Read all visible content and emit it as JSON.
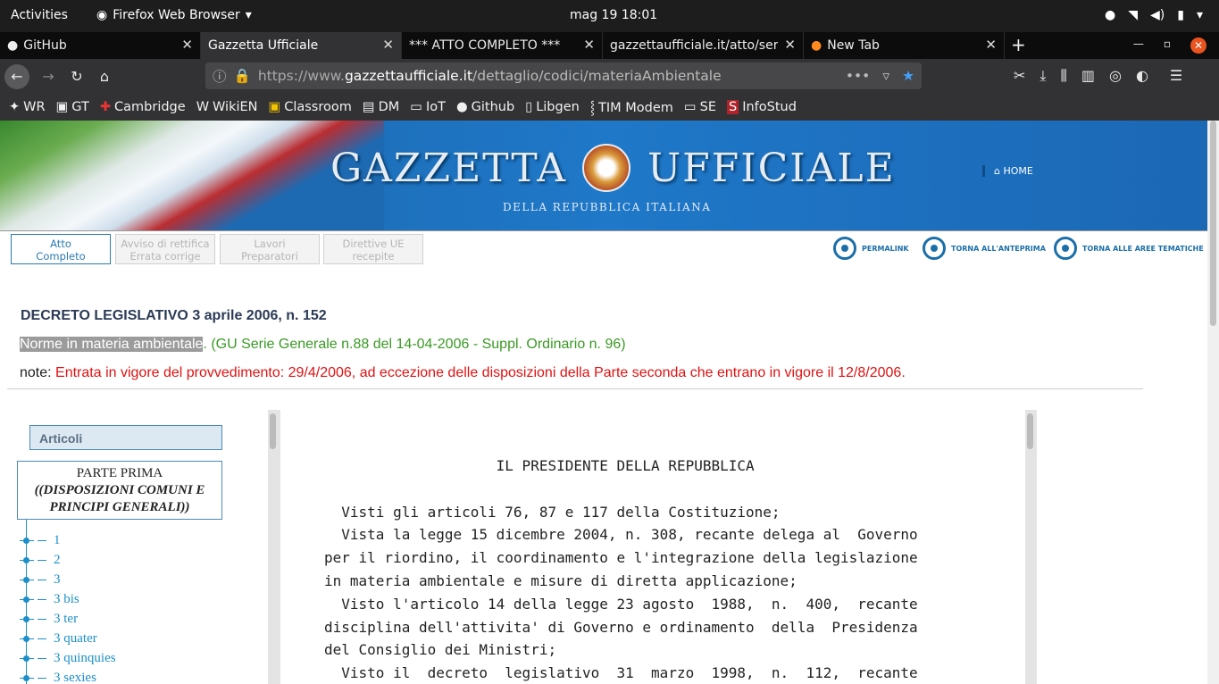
{
  "system": {
    "activities": "Activities",
    "app": "Firefox Web Browser",
    "clock": "mag 19  18:01"
  },
  "tabs": [
    {
      "label": "GitHub"
    },
    {
      "label": "Gazzetta Ufficiale"
    },
    {
      "label": "*** ATTO COMPLETO ***"
    },
    {
      "label": "gazzettaufficiale.it/atto/seri"
    },
    {
      "label": "New Tab"
    }
  ],
  "url": {
    "prefix": "https://www.",
    "domain": "gazzettaufficiale.it",
    "path": "/dettaglio/codici/materiaAmbientale"
  },
  "bookmarks": [
    "WR",
    "GT",
    "Cambridge",
    "WikiEN",
    "Classroom",
    "DM",
    "IoT",
    "Github",
    "Libgen",
    "TIM Modem",
    "SE",
    "InfoStud"
  ],
  "banner": {
    "title_left": "GAZZETTA",
    "title_right": "UFFICIALE",
    "subtitle": "DELLA REPUBBLICA ITALIANA",
    "home": "HOME"
  },
  "subnav": {
    "buttons": [
      {
        "l1": "Atto",
        "l2": "Completo"
      },
      {
        "l1": "Avviso di rettifica",
        "l2": "Errata corrige"
      },
      {
        "l1": "Lavori",
        "l2": "Preparatori"
      },
      {
        "l1": "Direttive UE",
        "l2": "recepite"
      }
    ],
    "links": [
      "PERMALINK",
      "TORNA ALL'ANTEPRIMA",
      "TORNA ALLE AREE TEMATICHE"
    ]
  },
  "doc": {
    "title": "DECRETO LEGISLATIVO 3 aprile 2006, n. 152",
    "highlight": "Norme in materia ambientale",
    "gu": ". (GU Serie Generale n.88 del 14-04-2006 - Suppl. Ordinario n. 96)",
    "note_label": "note: ",
    "note": "Entrata in vigore del provvedimento: 29/4/2006, ad eccezione delle disposizioni della Parte seconda che entrano in vigore il 12/8/2006."
  },
  "toc": {
    "head": "Articoli",
    "part_l1": "PARTE PRIMA",
    "part_l2": "((DISPOSIZIONI COMUNI E",
    "part_l3": "PRINCIPI GENERALI))",
    "items": [
      "1",
      "2",
      "3",
      "3 bis",
      "3 ter",
      "3 quater",
      "3 quinquies",
      "3 sexies"
    ]
  },
  "text": "                    IL PRESIDENTE DELLA REPUBBLICA\n\n  Visti gli articoli 76, 87 e 117 della Costituzione;\n  Vista la legge 15 dicembre 2004, n. 308, recante delega al  Governo\nper il riordino, il coordinamento e l'integrazione della legislazione\nin materia ambientale e misure di diretta applicazione;\n  Visto l'articolo 14 della legge 23 agosto  1988,  n.  400,  recante\ndisciplina dell'attivita' di Governo e ordinamento  della  Presidenza\ndel Consiglio dei Ministri;\n  Visto il  decreto  legislativo  31  marzo  1998,  n.  112,  recante"
}
